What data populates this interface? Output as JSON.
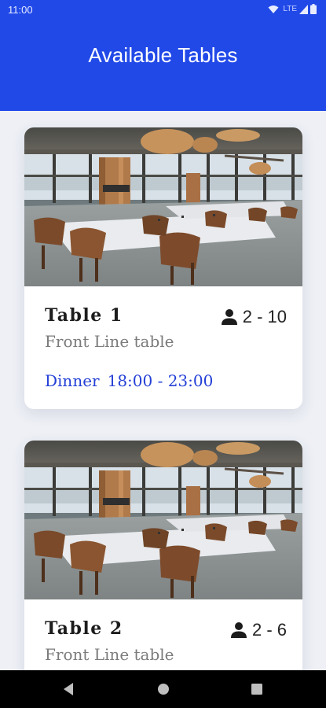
{
  "status_bar": {
    "time": "11:00",
    "network": "LTE",
    "icons": [
      "wifi-icon",
      "cellular-signal-icon",
      "battery-icon"
    ]
  },
  "app_bar": {
    "title": "Available Tables",
    "color": "#2149e8"
  },
  "tables": [
    {
      "name": "Table 1",
      "capacity": "2 - 10",
      "location": "Front Line table",
      "meal": "Dinner",
      "hours": "18:00 - 23:00",
      "photo": "restaurant-dining-room-photo"
    },
    {
      "name": "Table 2",
      "capacity": "2 - 6",
      "location": "Front Line table",
      "photo": "restaurant-dining-room-photo"
    }
  ],
  "nav_bar": {
    "buttons": [
      "back-icon",
      "home-icon",
      "recents-icon"
    ]
  },
  "colors": {
    "accent": "#2440d6",
    "background": "#eef0f6",
    "card": "#ffffff",
    "muted_text": "#7b7b7b"
  }
}
